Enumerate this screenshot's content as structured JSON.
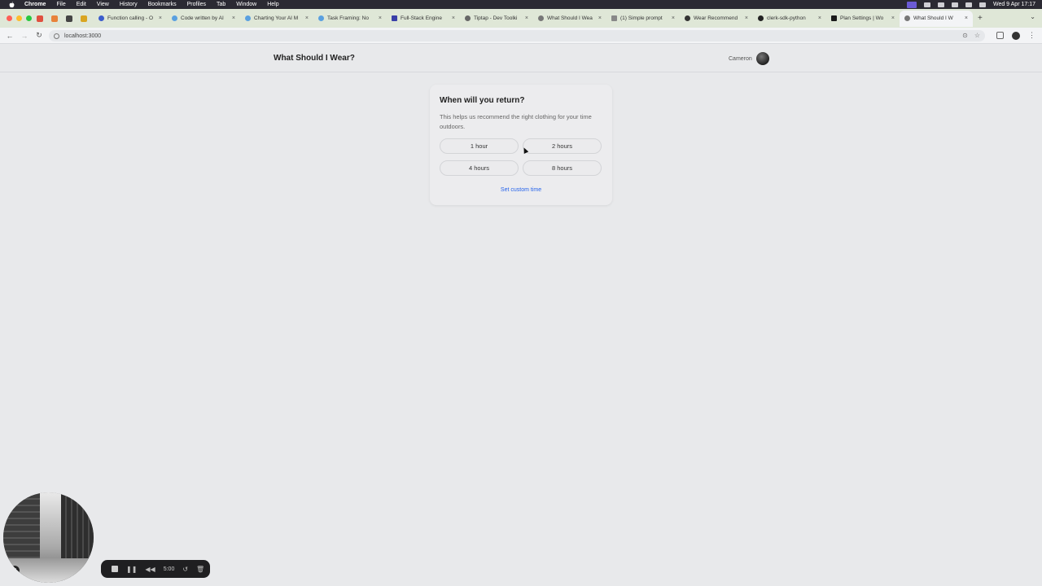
{
  "menubar": {
    "app": "Chrome",
    "items": [
      "File",
      "Edit",
      "View",
      "History",
      "Bookmarks",
      "Profiles",
      "Tab",
      "Window",
      "Help"
    ],
    "clock": "Wed 9 Apr  17:17"
  },
  "tabs": [
    {
      "title": "Function calling - O"
    },
    {
      "title": "Code written by AI"
    },
    {
      "title": "Charting Your AI M"
    },
    {
      "title": "Task Framing: No"
    },
    {
      "title": "Full-Stack Engine"
    },
    {
      "title": "Tiptap - Dev Toolki"
    },
    {
      "title": "What Should I Wea"
    },
    {
      "title": "(1) Simple prompt"
    },
    {
      "title": "Wear Recommend"
    },
    {
      "title": "clerk-sdk-python"
    },
    {
      "title": "Plan Settings | Wo"
    },
    {
      "title": "What Should I W"
    }
  ],
  "address": {
    "url": "localhost:3000"
  },
  "app": {
    "title": "What Should I Wear?",
    "user_name": "Cameron"
  },
  "card": {
    "title": "When will you return?",
    "description": "This helps us recommend the right clothing for your time outdoors.",
    "options": [
      "1 hour",
      "2 hours",
      "4 hours",
      "8 hours"
    ],
    "custom_link": "Set custom time",
    "link_color": "#2563eb"
  },
  "recorder": {
    "timer": "5:00"
  }
}
